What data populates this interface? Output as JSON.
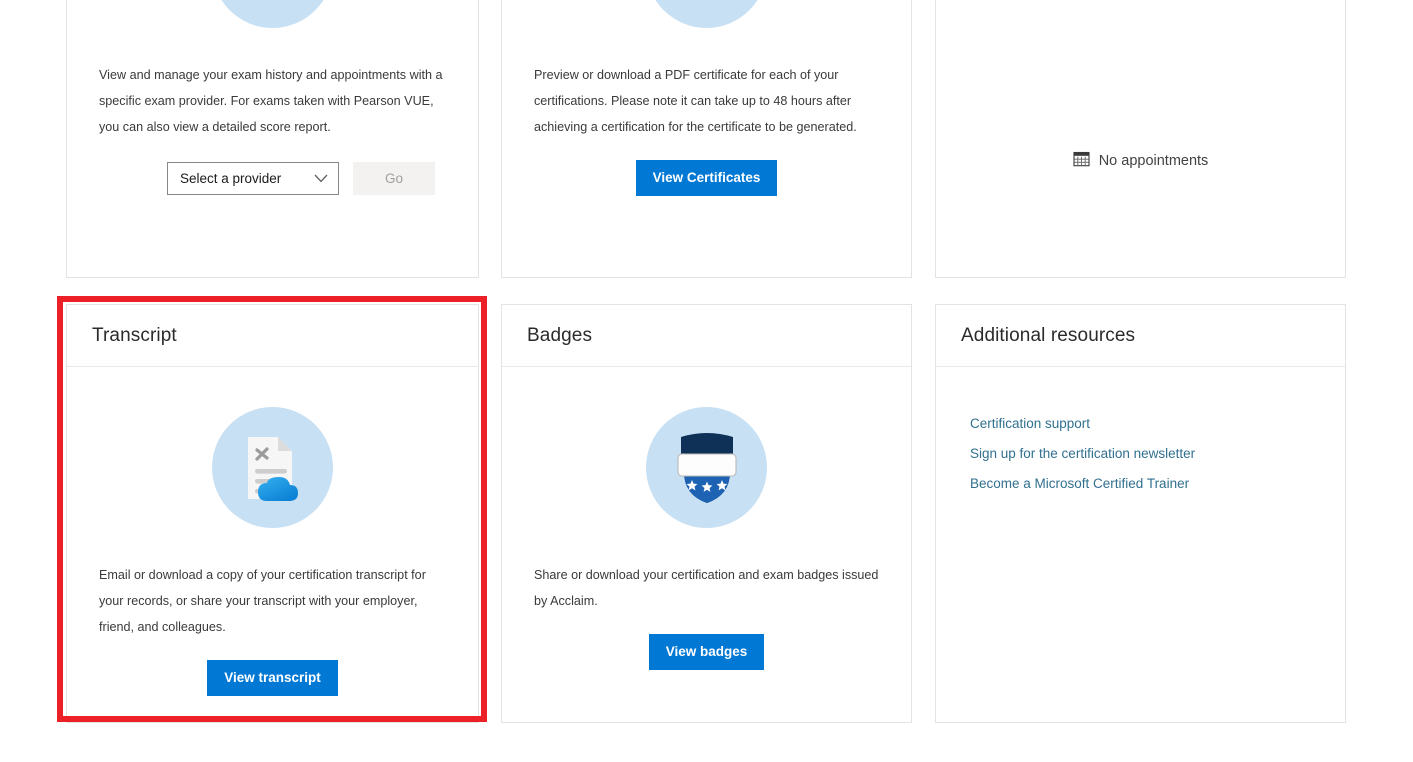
{
  "cards": {
    "exam_history": {
      "description": "View and manage your exam history and appointments with a specific exam provider. For exams taken with Pearson VUE, you can also view a detailed score report.",
      "select_value": "Select a provider",
      "go_label": "Go",
      "icon": "robot-arm-icon"
    },
    "certificates": {
      "description": "Preview or download a PDF certificate for each of your certifications. Please note it can take up to 48 hours after achieving a certification for the certificate to be generated.",
      "button_label": "View Certificates",
      "icon": "certificate-icon"
    },
    "appointments": {
      "empty_text": "No appointments",
      "icon": "calendar-icon"
    },
    "transcript": {
      "title": "Transcript",
      "description": "Email or download a copy of your certification transcript for your records, or share your transcript with your employer, friend, and colleagues.",
      "button_label": "View transcript",
      "icon": "transcript-cloud-icon"
    },
    "badges": {
      "title": "Badges",
      "description": "Share or download your certification and exam badges issued by Acclaim.",
      "button_label": "View badges",
      "icon": "badge-shield-icon"
    },
    "additional_resources": {
      "title": "Additional resources",
      "links": [
        {
          "label": "Certification support"
        },
        {
          "label": "Sign up for the certification newsletter"
        },
        {
          "label": "Become a Microsoft Certified Trainer"
        }
      ]
    }
  },
  "colors": {
    "accent_blue": "#0078d4",
    "illustration_circle": "#c7e0f4",
    "link_blue": "#31708f",
    "highlight_red": "#ec2027",
    "card_border": "#e3e3e3",
    "disabled_button_bg": "#f3f2f1"
  }
}
